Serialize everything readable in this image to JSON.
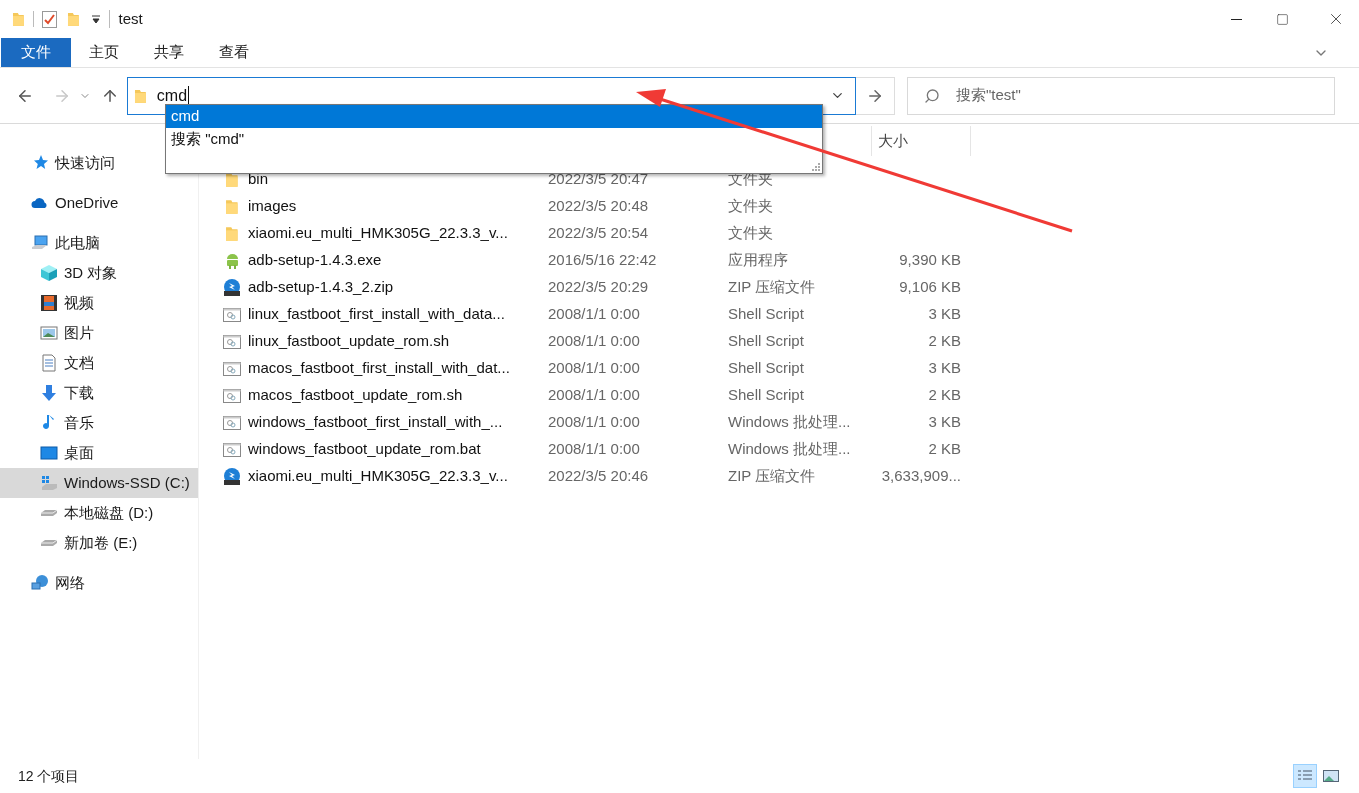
{
  "window": {
    "title": "test"
  },
  "ribbon_tabs": [
    {
      "label": "文件",
      "selected": true
    },
    {
      "label": "主页",
      "selected": false
    },
    {
      "label": "共享",
      "selected": false
    },
    {
      "label": "查看",
      "selected": false
    }
  ],
  "address": {
    "value": "cmd",
    "suggestions": [
      {
        "label": "cmd",
        "selected": true
      },
      {
        "label": "搜索 \"cmd\"",
        "selected": false
      }
    ]
  },
  "search": {
    "placeholder": "搜索\"test\""
  },
  "sidebar": {
    "items": [
      {
        "label": "快速访问",
        "kind": "star",
        "selected": false
      },
      {
        "label": "OneDrive",
        "kind": "cloud",
        "selected": false
      },
      {
        "label": "此电脑",
        "kind": "pc",
        "selected": false,
        "children": [
          {
            "label": "3D 对象",
            "kind": "cube",
            "selected": false
          },
          {
            "label": "视频",
            "kind": "film",
            "selected": false
          },
          {
            "label": "图片",
            "kind": "image",
            "selected": false
          },
          {
            "label": "文档",
            "kind": "doc",
            "selected": false
          },
          {
            "label": "下载",
            "kind": "download",
            "selected": false
          },
          {
            "label": "音乐",
            "kind": "music",
            "selected": false
          },
          {
            "label": "桌面",
            "kind": "desktop",
            "selected": false
          },
          {
            "label": "Windows-SSD (C:)",
            "kind": "windrive",
            "selected": true
          },
          {
            "label": "本地磁盘 (D:)",
            "kind": "drive",
            "selected": false
          },
          {
            "label": "新加卷 (E:)",
            "kind": "drive",
            "selected": false
          }
        ]
      },
      {
        "label": "网络",
        "kind": "network",
        "selected": false
      }
    ]
  },
  "table": {
    "columns": [
      "大小"
    ],
    "rows": [
      {
        "kind": "folder",
        "name": "bin",
        "date": "2022/3/5 20:47",
        "type": "文件夹",
        "size": ""
      },
      {
        "kind": "folder",
        "name": "images",
        "date": "2022/3/5 20:48",
        "type": "文件夹",
        "size": ""
      },
      {
        "kind": "folder",
        "name": "xiaomi.eu_multi_HMK305G_22.3.3_v...",
        "date": "2022/3/5 20:54",
        "type": "文件夹",
        "size": ""
      },
      {
        "kind": "android",
        "name": "adb-setup-1.4.3.exe",
        "date": "2016/5/16 22:42",
        "type": "应用程序",
        "size": "9,390 KB"
      },
      {
        "kind": "zip",
        "name": "adb-setup-1.4.3_2.zip",
        "date": "2022/3/5 20:29",
        "type": "ZIP 压缩文件",
        "size": "9,106 KB"
      },
      {
        "kind": "script",
        "name": "linux_fastboot_first_install_with_data...",
        "date": "2008/1/1 0:00",
        "type": "Shell Script",
        "size": "3 KB"
      },
      {
        "kind": "script",
        "name": "linux_fastboot_update_rom.sh",
        "date": "2008/1/1 0:00",
        "type": "Shell Script",
        "size": "2 KB"
      },
      {
        "kind": "script",
        "name": "macos_fastboot_first_install_with_dat...",
        "date": "2008/1/1 0:00",
        "type": "Shell Script",
        "size": "3 KB"
      },
      {
        "kind": "script",
        "name": "macos_fastboot_update_rom.sh",
        "date": "2008/1/1 0:00",
        "type": "Shell Script",
        "size": "2 KB"
      },
      {
        "kind": "script",
        "name": "windows_fastboot_first_install_with_...",
        "date": "2008/1/1 0:00",
        "type": "Windows 批处理...",
        "size": "3 KB"
      },
      {
        "kind": "script",
        "name": "windows_fastboot_update_rom.bat",
        "date": "2008/1/1 0:00",
        "type": "Windows 批处理...",
        "size": "2 KB"
      },
      {
        "kind": "zip",
        "name": "xiaomi.eu_multi_HMK305G_22.3.3_v...",
        "date": "2022/3/5 20:46",
        "type": "ZIP 压缩文件",
        "size": "3,633,909..."
      }
    ]
  },
  "status_bar": {
    "count": "12 个项目",
    "views": [
      {
        "kind": "details",
        "selected": true
      },
      {
        "kind": "tiles",
        "selected": false
      }
    ]
  }
}
